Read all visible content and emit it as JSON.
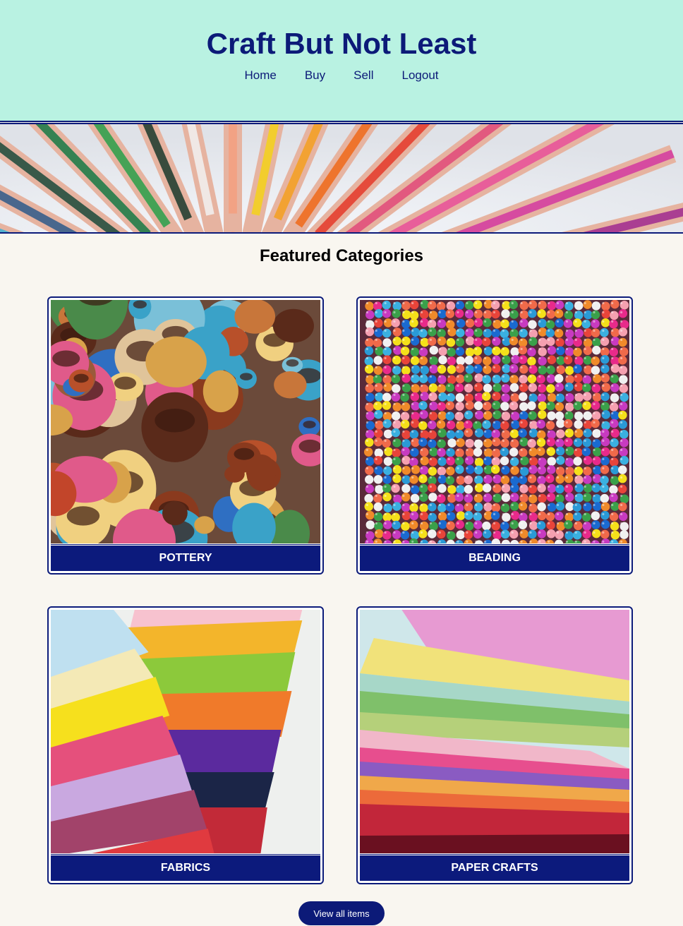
{
  "site": {
    "title": "Craft But Not Least"
  },
  "nav": [
    {
      "label": "Home"
    },
    {
      "label": "Buy"
    },
    {
      "label": "Sell"
    },
    {
      "label": "Logout"
    }
  ],
  "banner": {
    "image": "colored-pencils-banner"
  },
  "featured": {
    "title": "Featured Categories",
    "categories": [
      {
        "label": "POTTERY",
        "image": "pottery-photo"
      },
      {
        "label": "BEADING",
        "image": "beads-photo"
      },
      {
        "label": "FABRICS",
        "image": "fabrics-photo"
      },
      {
        "label": "PAPER CRAFTS",
        "image": "paper-photo"
      }
    ]
  },
  "actions": {
    "view_all_label": "View all items"
  },
  "colors": {
    "header_bg": "#b9f2e2",
    "brand_navy": "#0c1a78",
    "page_bg": "#f9f6f0"
  }
}
